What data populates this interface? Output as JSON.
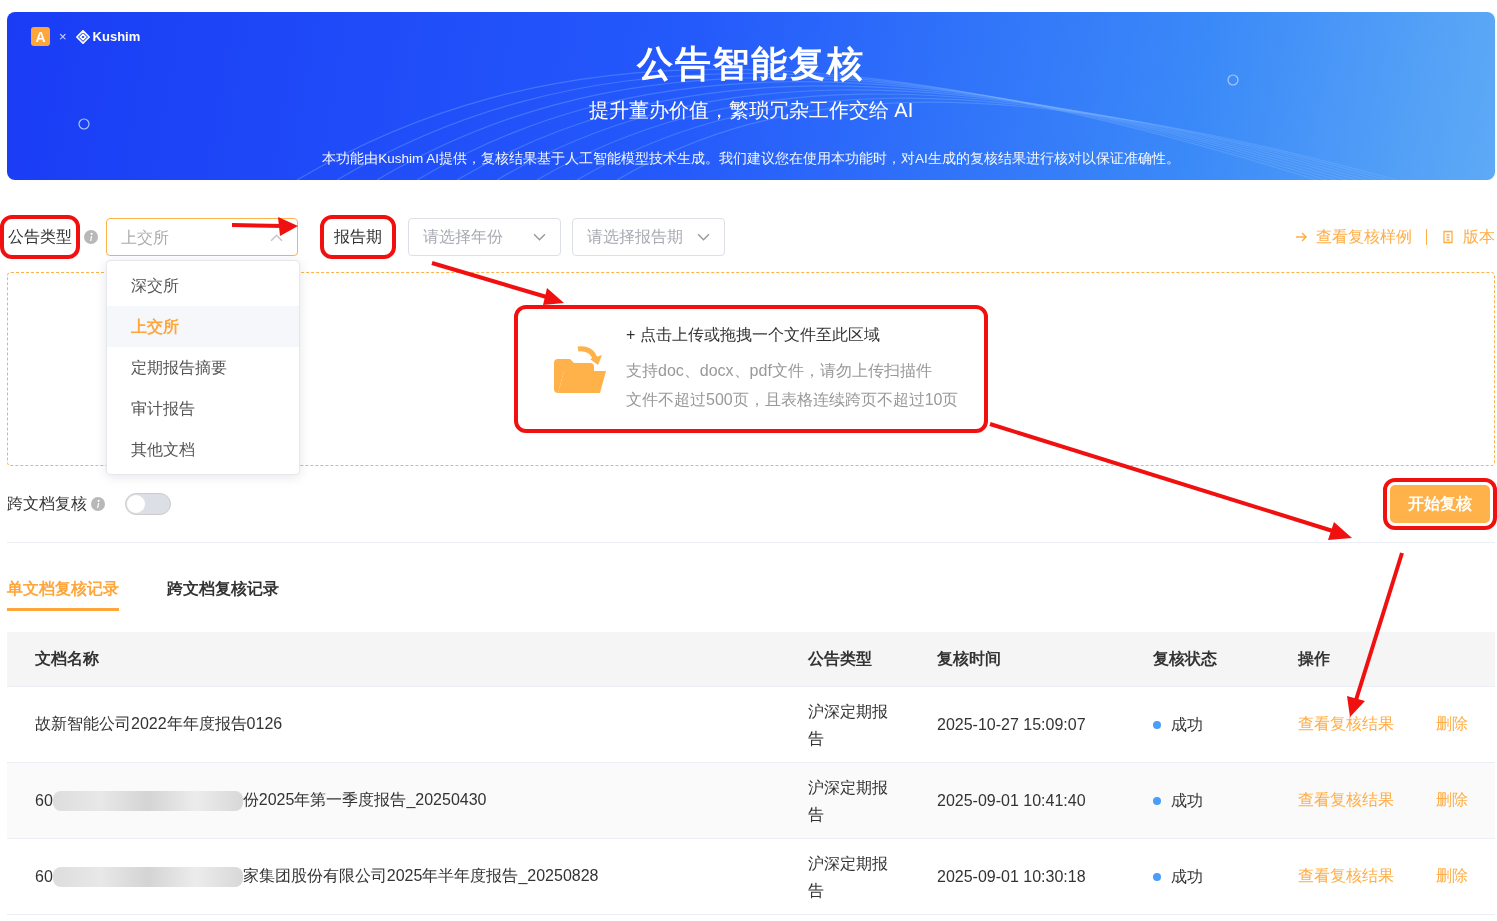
{
  "banner": {
    "logo": {
      "mark": "A",
      "separator": "×",
      "brand": "Kushim"
    },
    "title": "公告智能复核",
    "subtitle": "提升董办价值，繁琐冗杂工作交给 AI",
    "disclaimer": "本功能由Kushim AI提供，复核结果基于人工智能模型技术生成。我们建议您在使用本功能时，对AI生成的复核结果进行核对以保证准确性。"
  },
  "filters": {
    "type_label": {
      "text": "公告类型",
      "highlighted": true
    },
    "type_select": {
      "value": "上交所",
      "expanded": true,
      "options": [
        {
          "label": "深交所",
          "selected": false
        },
        {
          "label": "上交所",
          "selected": true
        },
        {
          "label": "定期报告摘要",
          "selected": false
        },
        {
          "label": "审计报告",
          "selected": false
        },
        {
          "label": "其他文档",
          "selected": false
        }
      ]
    },
    "period_label": {
      "text": "报告期",
      "highlighted": true
    },
    "year_select": {
      "placeholder": "请选择年份"
    },
    "period_select": {
      "placeholder": "请选择报告期"
    }
  },
  "links": [
    {
      "kind": "arrow",
      "label": "查看复核样例"
    },
    {
      "kind": "doc",
      "label": "版本"
    }
  ],
  "upload": {
    "highlighted": true,
    "title": "+ 点击上传或拖拽一个文件至此区域",
    "hints": [
      "支持doc、docx、pdf文件，请勿上传扫描件",
      "文件不超过500页，且表格连续跨页不超过10页"
    ]
  },
  "cross_doc": {
    "label": "跨文档复核",
    "on": false
  },
  "start_button": {
    "label": "开始复核",
    "highlighted": true
  },
  "tabs": [
    {
      "label": "单文档复核记录",
      "selected": true
    },
    {
      "label": "跨文档复核记录",
      "selected": false
    }
  ],
  "table": {
    "columns": [
      "文档名称",
      "公告类型",
      "复核时间",
      "复核状态",
      "操作"
    ],
    "rows": [
      {
        "name_start": "故新智能公司2022年年度报告0126",
        "redacted": false,
        "type": "沪深定期报告",
        "time": "2025-10-27 15:09:07",
        "status": "成功",
        "color": "#4a9df8",
        "view": "查看复核结果",
        "delete": "删除"
      },
      {
        "name_start": "60",
        "redacted": true,
        "name_end": "份2025年第一季度报告_20250430",
        "type": "沪深定期报告",
        "time": "2025-09-01 10:41:40",
        "status": "成功",
        "color": "#4a9df8",
        "view": "查看复核结果",
        "delete": "删除"
      },
      {
        "name_start": "60",
        "redacted": true,
        "name_end": "家集团股份有限公司2025年半年度报告_20250828",
        "type": "沪深定期报告",
        "time": "2025-09-01 10:30:18",
        "status": "成功",
        "color": "#4a9df8",
        "view": "查看复核结果",
        "delete": "删除"
      }
    ]
  }
}
